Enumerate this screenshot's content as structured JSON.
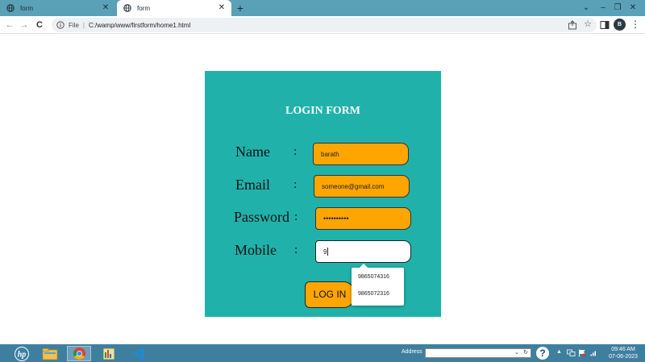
{
  "browser": {
    "tabs": [
      {
        "label": "form",
        "active": false
      },
      {
        "label": "form",
        "active": true
      }
    ],
    "new_tab": "+",
    "window_controls": {
      "dropdown": "⌄",
      "minimize": "–",
      "restore": "❐",
      "close": "✕"
    },
    "nav": {
      "back": "←",
      "forward": "→",
      "reload": "C"
    },
    "address": {
      "scheme_label": "File",
      "separator": "|",
      "url": "C:/wamp/www/firstform/home1.html"
    },
    "profile_initial": "B",
    "menu": "⋮"
  },
  "form": {
    "title": "LOGIN FORM",
    "colon": ":",
    "fields": {
      "name": {
        "label": "Name",
        "value": "barath"
      },
      "email": {
        "label": "Email",
        "value": "someone@gmail.com"
      },
      "password": {
        "label": "Password",
        "value": "••••••••••"
      },
      "mobile": {
        "label": "Mobile",
        "value": "9"
      }
    },
    "login_button": "LOG IN",
    "suggestions": [
      "9865074316",
      "9865072316"
    ],
    "colors": {
      "card": "#20b2aa",
      "field": "#ffa500",
      "title": "#ffffff"
    }
  },
  "taskbar": {
    "address_label": "Address",
    "address_value": "",
    "dropdown": "⌄",
    "refresh": "↻",
    "help": "?",
    "tray_arrow": "▲",
    "clock_time": "09:46 AM",
    "clock_date": "07-06-2023",
    "apps": [
      "hp-logo-icon",
      "file-explorer-icon",
      "chrome-icon",
      "image-viewer-icon",
      "vscode-icon"
    ]
  }
}
